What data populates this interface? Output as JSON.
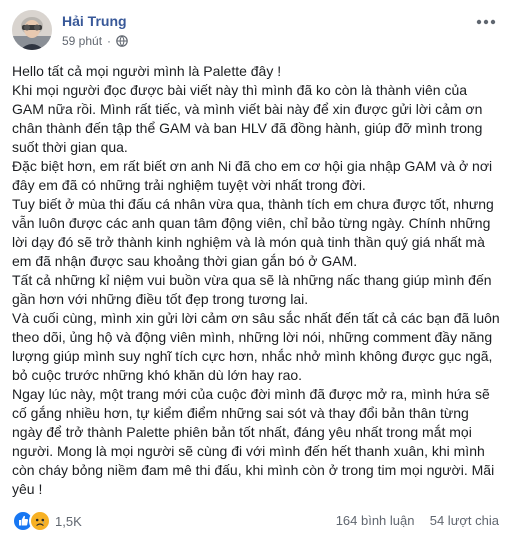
{
  "post": {
    "author": "Hải Trung",
    "time": "59 phút",
    "separator": "·",
    "privacy_icon": "globe-icon",
    "more_icon": "more-options-icon",
    "paragraphs": [
      "Hello tất cả mọi người mình là Palette đây !",
      "Khi mọi người đọc được bài viết này thì mình đã ko còn là thành viên của GAM nữa rồi. Mình rất tiếc, và mình viết bài này để xin được gửi lời cảm ơn chân thành đến tập thể GAM và ban HLV đã đồng hành, giúp đỡ mình trong suốt thời gian qua.",
      "Đặc biệt hơn, em rất biết ơn anh Ni đã cho em cơ hội gia nhập GAM và ở nơi đây em đã có những trải nghiệm tuyệt vời nhất trong đời.",
      "Tuy biết ở mùa thi đấu cá nhân vừa qua, thành tích em chưa được tốt, nhưng vẫn luôn được các anh quan tâm động viên, chỉ bảo từng ngày. Chính những lời dạy đó sẽ trở thành kinh nghiệm và là món quà tinh thần quý giá nhất mà em đã nhận được sau khoảng thời gian gắn bó ở GAM.",
      "Tất cả những kỉ niệm vui buồn vừa qua sẽ là những nấc thang giúp mình đến gần hơn với những điều tốt đẹp trong tương lai.",
      "Và cuối cùng, mình xin gửi lời cảm ơn sâu sắc nhất đến tất cả các bạn đã luôn theo dõi, ủng hộ và động viên mình, những lời nói, những comment đầy năng lượng giúp mình suy nghĩ tích cực hơn, nhắc nhở mình không được gục ngã, bỏ cuộc trước những khó khăn dù lớn hay rao.",
      "Ngay lúc này, một trang mới của cuộc đời mình đã được mở ra, mình hứa sẽ cố gắng nhiều hơn, tự kiểm điểm những sai sót và thay đổi bản thân từng ngày để trở thành Palette phiên bản tốt nhất, đáng yêu nhất trong mắt mọi người. Mong là mọi người sẽ cùng đi với mình đến hết thanh xuân, khi mình còn cháy bỏng niềm đam mê thi đấu, khi mình còn ở trong tim mọi người. Mãi yêu !"
    ],
    "reactions": {
      "icons": [
        "like-icon",
        "sad-icon"
      ],
      "colors": {
        "like": "#1877f2",
        "sad": "#f7b125"
      },
      "count": "1,5K"
    },
    "comments": "164 bình luận",
    "shares": "54 lượt chia"
  },
  "colors": {
    "author": "#385898",
    "text": "#1c1e21",
    "meta": "#616770"
  }
}
